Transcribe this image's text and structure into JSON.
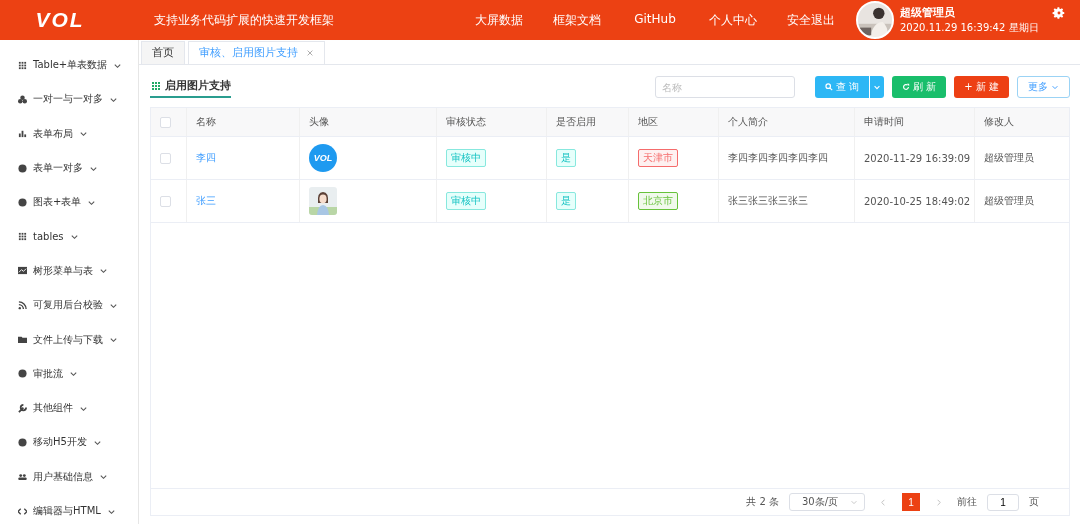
{
  "header": {
    "logo": "VOL",
    "slogan": "支持业务代码扩展的快速开发框架",
    "nav": [
      "大屏数据",
      "框架文档",
      "GitHub",
      "个人中心",
      "安全退出"
    ],
    "user": {
      "name": "超级管理员",
      "datetime": "2020.11.29 16:39:42 星期日"
    }
  },
  "sidebar": {
    "items": [
      {
        "label": "Table+单表数据",
        "expanded": false
      },
      {
        "label": "一对一与一对多",
        "expanded": false
      },
      {
        "label": "表单布局",
        "expanded": false
      },
      {
        "label": "表单一对多",
        "expanded": false
      },
      {
        "label": "图表+表单",
        "expanded": false
      },
      {
        "label": "tables",
        "expanded": false
      },
      {
        "label": "树形菜单与表",
        "expanded": false
      },
      {
        "label": "可复用后台校验",
        "expanded": false
      },
      {
        "label": "文件上传与下载",
        "expanded": false
      },
      {
        "label": "审批流",
        "expanded": false
      },
      {
        "label": "其他组件",
        "expanded": false
      },
      {
        "label": "移动H5开发",
        "expanded": false
      },
      {
        "label": "用户基础信息",
        "expanded": false
      },
      {
        "label": "编辑器与HTML",
        "expanded": false
      }
    ]
  },
  "tabs": [
    {
      "label": "首页",
      "selected": false,
      "closable": false
    },
    {
      "label": "审核、启用图片支持",
      "selected": true,
      "closable": true
    }
  ],
  "panel": {
    "title": "启用图片支持",
    "search": {
      "placeholder": "名称"
    },
    "buttons": [
      {
        "kind": "query",
        "label": "查 询"
      },
      {
        "kind": "refresh",
        "label": "刷 新"
      },
      {
        "kind": "add",
        "label": "+ 新 建"
      },
      {
        "kind": "more",
        "label": "更多"
      }
    ]
  },
  "table": {
    "all_checked": false,
    "columns": [
      "名称",
      "头像",
      "审核状态",
      "是否启用",
      "地区",
      "个人简介",
      "申请时间",
      "修改人"
    ],
    "rows": [
      {
        "checked": false,
        "name": "李四",
        "avatar": {
          "kind": "logo",
          "text": "VOL"
        },
        "status": "审核中",
        "enabled": "是",
        "region": {
          "label": "天津市",
          "color": "#f56c6c"
        },
        "bio": "李四李四李四李四李四",
        "time": "2020-11-29 16:39:09",
        "editor": "超级管理员"
      },
      {
        "checked": false,
        "name": "张三",
        "status": "审核中",
        "enabled": "是",
        "region": {
          "label": "北京市",
          "color": "#67c23a"
        },
        "bio": "张三张三张三张三",
        "time": "2020-10-25 18:49:02",
        "editor": "超级管理员"
      }
    ]
  },
  "pagination": {
    "total": "共 2 条",
    "page_size": "30条/页",
    "pages": [
      {
        "label": "1",
        "selected": true
      }
    ],
    "goto_label": "前往",
    "goto_value": "1",
    "goto_suffix": "页"
  }
}
